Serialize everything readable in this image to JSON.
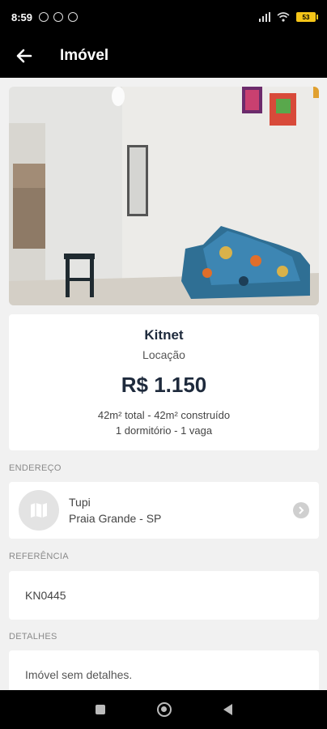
{
  "status_bar": {
    "time": "8:59",
    "battery": "53"
  },
  "app_bar": {
    "title": "Imóvel",
    "back_icon": "arrow-left-icon"
  },
  "property": {
    "type": "Kitnet",
    "transaction": "Locação",
    "price": "R$ 1.150",
    "area": "42m² total - 42m² construído",
    "rooms": "1 dormitório - 1 vaga"
  },
  "address": {
    "label": "ENDEREÇO",
    "neighborhood": "Tupi",
    "city": "Praia Grande - SP",
    "icon": "map-icon"
  },
  "reference": {
    "label": "REFERÊNCIA",
    "code": "KN0445"
  },
  "details": {
    "label": "DETALHES",
    "text": "Imóvel sem detalhes."
  },
  "colors": {
    "bar": "#000000",
    "primary_text": "#1e2a3c",
    "background": "#f1f1f1"
  }
}
